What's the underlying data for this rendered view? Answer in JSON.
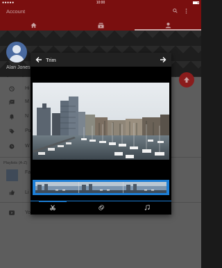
{
  "status_bar": {
    "signal": "●●●●●",
    "time": "10:00"
  },
  "app_bar": {
    "title": "Account",
    "search_icon": "search-icon",
    "more_icon": "more-vert-icon"
  },
  "tabs": [
    {
      "icon": "home-icon"
    },
    {
      "icon": "subscriptions-icon"
    },
    {
      "icon": "account-icon",
      "selected": true
    }
  ],
  "account": {
    "name": "Alan Jones"
  },
  "menu": [
    {
      "icon": "history-icon",
      "label": "Hi"
    },
    {
      "icon": "video-library-icon",
      "label": "M"
    },
    {
      "icon": "notifications-icon",
      "label": "N"
    },
    {
      "icon": "tag-icon",
      "label": "Pu"
    },
    {
      "icon": "clock-icon",
      "label": "W"
    }
  ],
  "playlists": {
    "section_label": "Playlists (A-Z)",
    "items": [
      {
        "label": "Fa"
      },
      {
        "label": "Li"
      },
      {
        "label": "Yo"
      }
    ]
  },
  "trim_dialog": {
    "title": "Trim",
    "back_icon": "arrow-back-icon",
    "next_icon": "arrow-forward-icon",
    "footer_icons": [
      "scissors-icon",
      "filter-icon",
      "music-note-icon"
    ]
  },
  "colors": {
    "accent": "#1d7fd6",
    "brand_red": "#b31217"
  }
}
